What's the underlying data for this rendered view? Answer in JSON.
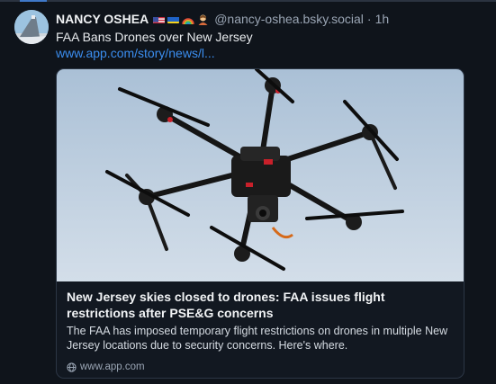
{
  "post": {
    "display_name": "NANCY OSHEA",
    "handle": "@nancy-oshea.bsky.social",
    "separator": "·",
    "time": "1h",
    "text": "FAA Bans Drones over New Jersey",
    "link_text": "www.app.com/story/news/l...",
    "badges": [
      "us-flag-emoji",
      "ukraine-flag-emoji",
      "rainbow-emoji",
      "person-emoji"
    ]
  },
  "card": {
    "title": "New Jersey skies closed to drones: FAA issues flight restrictions after PSE&G concerns",
    "description": "The FAA has imposed temporary flight restrictions on drones in multiple New Jersey locations due to security concerns. Here's where.",
    "domain": "www.app.com",
    "image": "hexacopter-drone-photo"
  },
  "colors": {
    "background": "#0f141b",
    "link": "#3b8ef0",
    "card_border": "#2c3645",
    "sky": "#c6d4e2"
  }
}
